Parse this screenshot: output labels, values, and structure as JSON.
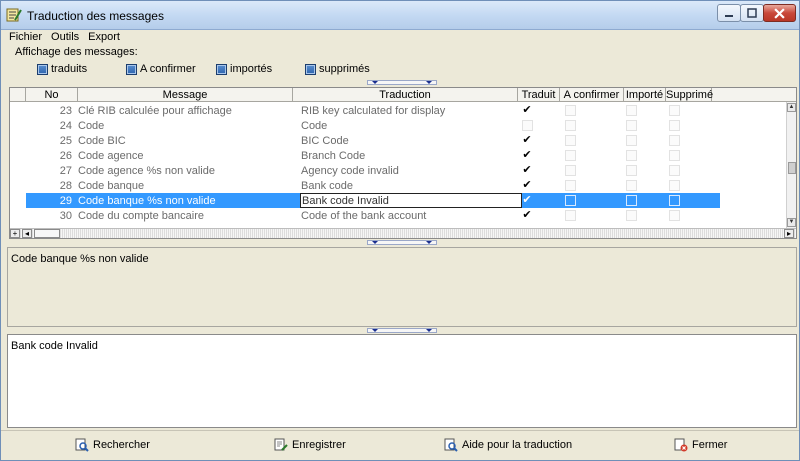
{
  "window": {
    "title": "Traduction des messages"
  },
  "menu": [
    "Fichier",
    "Outils",
    "Export"
  ],
  "filters": {
    "label": "Affichage des messages:",
    "items": [
      {
        "label": "traduits",
        "checked": true
      },
      {
        "label": "A confirmer",
        "checked": true
      },
      {
        "label": "importés",
        "checked": true
      },
      {
        "label": "supprimés",
        "checked": true
      }
    ]
  },
  "grid": {
    "columns": [
      "No",
      "Message",
      "Traduction",
      "Traduit",
      "A confirmer",
      "Importé",
      "Supprimé"
    ],
    "rows": [
      {
        "no": "23",
        "message": "Clé RIB calculée pour affichage",
        "traduction": "RIB key calculated for display",
        "traduit": true
      },
      {
        "no": "24",
        "message": "Code",
        "traduction": "Code",
        "traduit": false
      },
      {
        "no": "25",
        "message": "Code BIC",
        "traduction": "BIC Code",
        "traduit": true
      },
      {
        "no": "26",
        "message": "Code agence",
        "traduction": "Branch Code",
        "traduit": true
      },
      {
        "no": "27",
        "message": "Code agence %s non valide",
        "traduction": "Agency code invalid",
        "traduit": true
      },
      {
        "no": "28",
        "message": "Code banque",
        "traduction": "Bank code",
        "traduit": true
      },
      {
        "no": "29",
        "message": "Code banque %s non valide",
        "traduction": "Bank code Invalid",
        "traduit": true,
        "selected": true
      },
      {
        "no": "30",
        "message": "Code du compte bancaire",
        "traduction": "Code of the bank account",
        "traduit": true
      }
    ]
  },
  "source_text": "Code banque %s non valide",
  "translation_text": "Bank code Invalid",
  "buttons": {
    "search": "Rechercher",
    "save": "Enregistrer",
    "help": "Aide pour la traduction",
    "close": "Fermer"
  }
}
